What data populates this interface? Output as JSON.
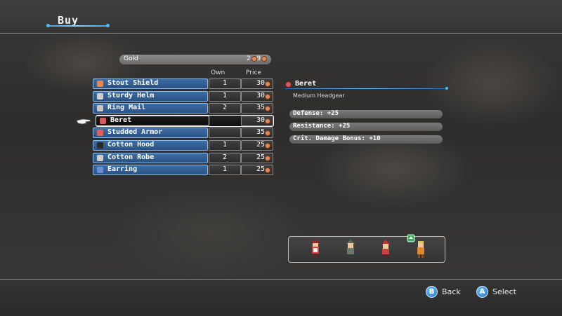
{
  "screen": {
    "title": "Buy"
  },
  "gold": {
    "label": "Gold",
    "value": "2"
  },
  "columns": {
    "own": "Own",
    "price": "Price"
  },
  "items": [
    {
      "name": "Stout Shield",
      "own": "1",
      "price": "30",
      "icon": "shield-icon",
      "color": "#e08a5a"
    },
    {
      "name": "Sturdy Helm",
      "own": "1",
      "price": "30",
      "icon": "helm-icon",
      "color": "#d0d0d0"
    },
    {
      "name": "Ring Mail",
      "own": "2",
      "price": "35",
      "icon": "armor-icon",
      "color": "#c8c8c8"
    },
    {
      "name": "Beret",
      "own": "",
      "price": "30",
      "icon": "beret-icon",
      "color": "#d85a5a",
      "selected": true
    },
    {
      "name": "Studded Armor",
      "own": "",
      "price": "35",
      "icon": "armor-icon",
      "color": "#e06060"
    },
    {
      "name": "Cotton Hood",
      "own": "1",
      "price": "25",
      "icon": "hood-icon",
      "color": "#2a2a2a"
    },
    {
      "name": "Cotton Robe",
      "own": "2",
      "price": "25",
      "icon": "robe-icon",
      "color": "#d0d0d0"
    },
    {
      "name": "Earring",
      "own": "1",
      "price": "25",
      "icon": "earring-icon",
      "color": "#6b8fd6"
    }
  ],
  "detail": {
    "name": "Beret",
    "category": "Medium Headgear",
    "stats": [
      "Defense:  +25",
      "Resistance:  +25",
      "Crit. Damage Bonus:  +10"
    ]
  },
  "hints": {
    "back_label": "Back",
    "select_label": "Select",
    "back_button": "B",
    "select_button": "A"
  },
  "colors": {
    "accent": "#3fa0e6",
    "row_fill": "#2a5182"
  }
}
